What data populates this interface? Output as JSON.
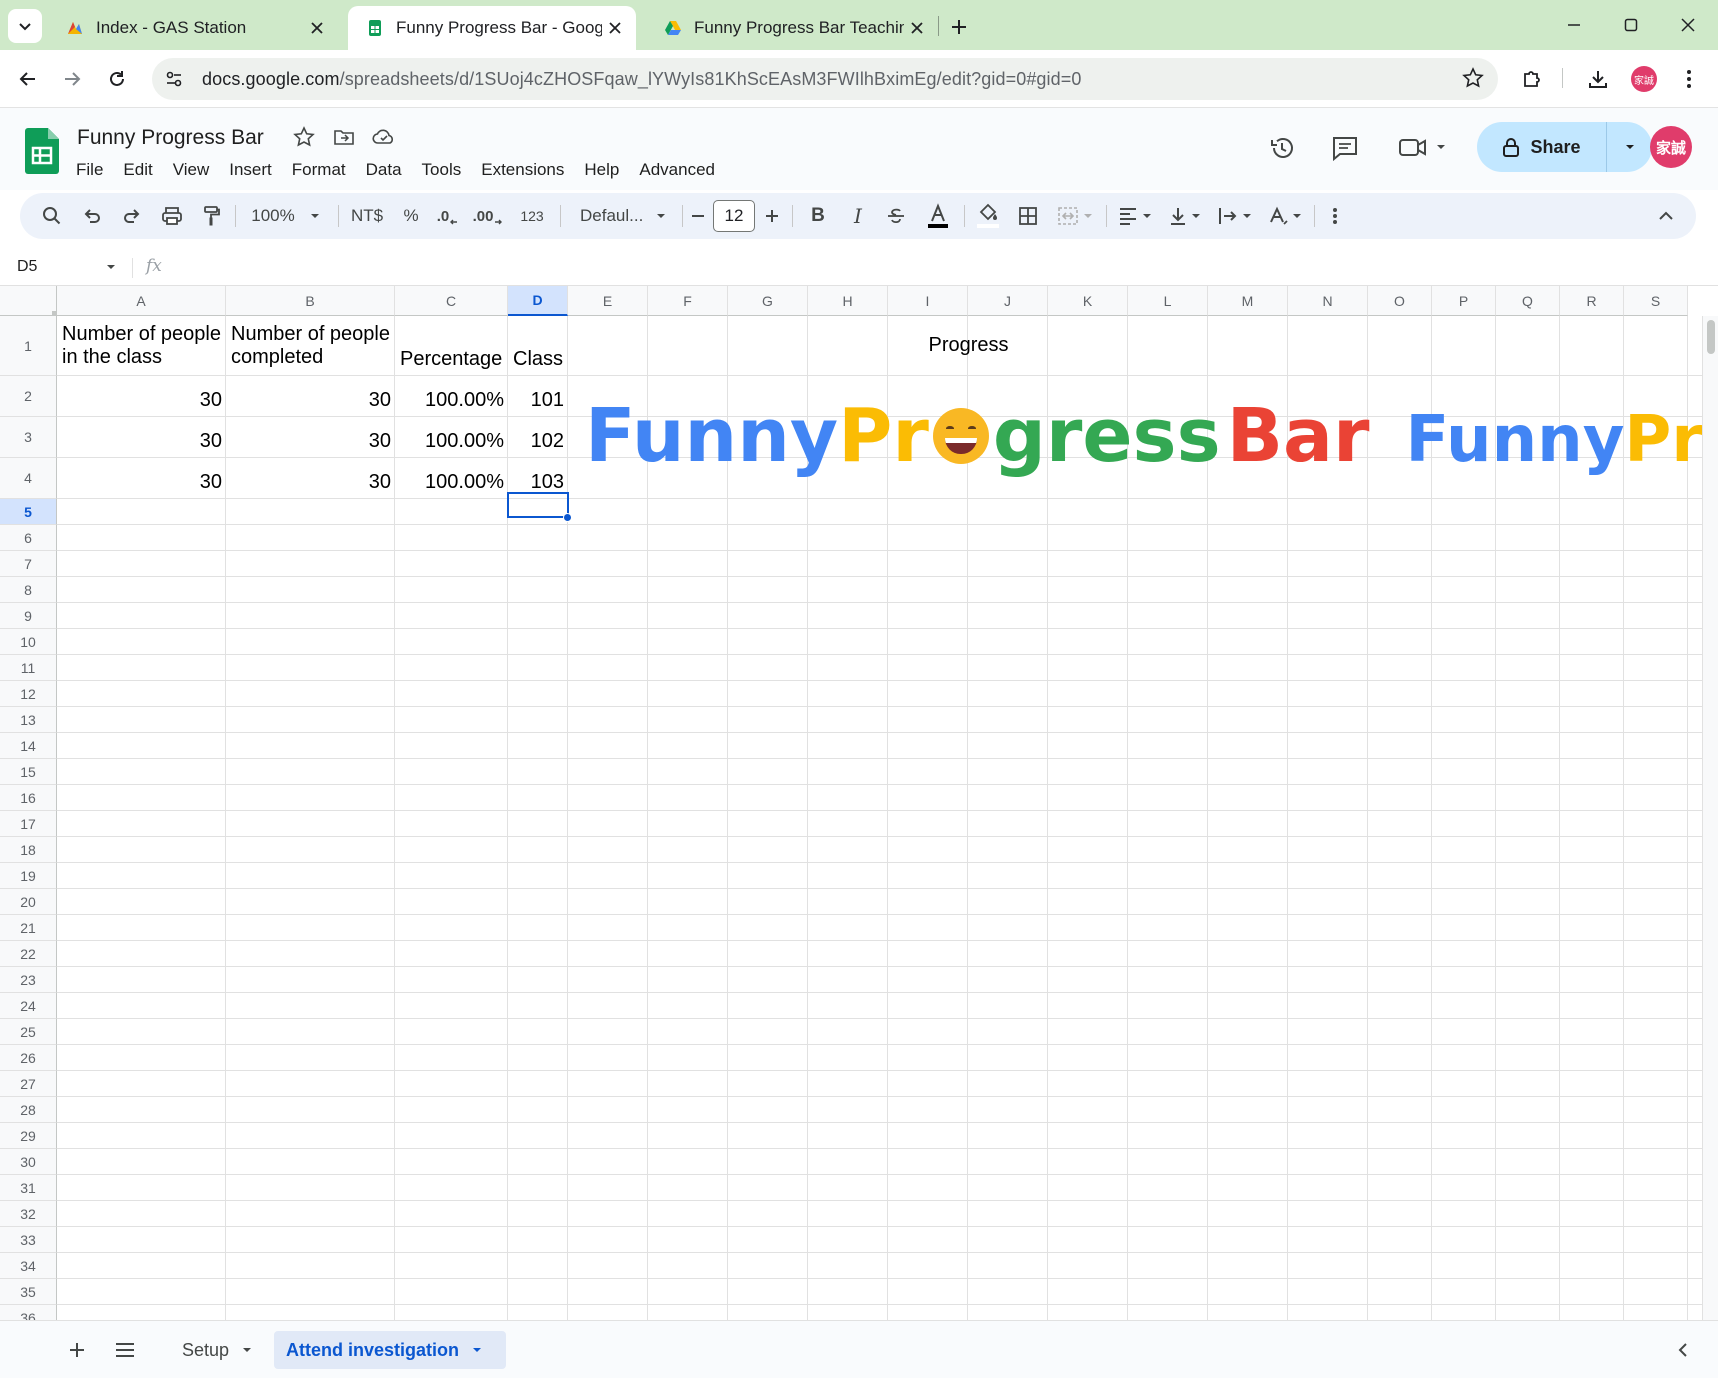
{
  "browser": {
    "tabs": [
      {
        "title": "Index - GAS Station",
        "active": false
      },
      {
        "title": "Funny Progress Bar - Google S",
        "active": true
      },
      {
        "title": "Funny Progress Bar Teaching -",
        "active": false
      }
    ],
    "url_host": "docs.google.com",
    "url_path": "/spreadsheets/d/1SUoj4cZHOSFqaw_lYWyIs81KhScEAsM3FWIlhBximEg/edit?gid=0#gid=0",
    "profile_label": "家誠"
  },
  "doc": {
    "title": "Funny Progress Bar",
    "menu": [
      "File",
      "Edit",
      "View",
      "Insert",
      "Format",
      "Data",
      "Tools",
      "Extensions",
      "Help",
      "Advanced"
    ],
    "share_label": "Share",
    "avatar_label": "家誠"
  },
  "toolbar": {
    "zoom": "100%",
    "currency": "NT$",
    "percent": "%",
    "dec_less": ".0",
    "dec_more": ".00",
    "num_format": "123",
    "font": "Defaul...",
    "font_size": "12"
  },
  "formula_bar": {
    "name_box": "D5",
    "fx": "fx",
    "content": ""
  },
  "grid": {
    "columns": [
      "A",
      "B",
      "C",
      "D",
      "E",
      "F",
      "G",
      "H",
      "I",
      "J",
      "K",
      "L",
      "M",
      "N",
      "O",
      "P",
      "Q",
      "R",
      "S"
    ],
    "selected_column": "D",
    "selected_row": 5,
    "row_count": 36,
    "header_row": {
      "a": [
        "Number of people",
        "in the class"
      ],
      "b": [
        "Number of people",
        "completed"
      ],
      "c": "Percentage",
      "d": "Class",
      "progress": "Progress"
    },
    "rows": [
      {
        "a": "30",
        "b": "30",
        "c": "100.00%",
        "d": "101"
      },
      {
        "a": "30",
        "b": "30",
        "c": "100.00%",
        "d": "102"
      },
      {
        "a": "30",
        "b": "30",
        "c": "100.00%",
        "d": "103"
      }
    ]
  },
  "progress_banner": {
    "word1": "Funny",
    "word2a": "Pr",
    "emoji": "😄",
    "word2b": "gress",
    "word3": "Bar",
    "repeat_word1": "Funny",
    "repeat_word2a": "Pr",
    "colors": {
      "funny": "#4285f4",
      "pr": "#fbbc04",
      "gress": "#34a853",
      "bar": "#ea4335"
    }
  },
  "sheet_tabs": [
    {
      "label": "Setup",
      "active": false
    },
    {
      "label": "Attend investigation",
      "active": true
    }
  ],
  "colors": {
    "accent": "#0b57d0",
    "sheets_green": "#0f9d58",
    "share_bg": "#c2e7ff"
  }
}
